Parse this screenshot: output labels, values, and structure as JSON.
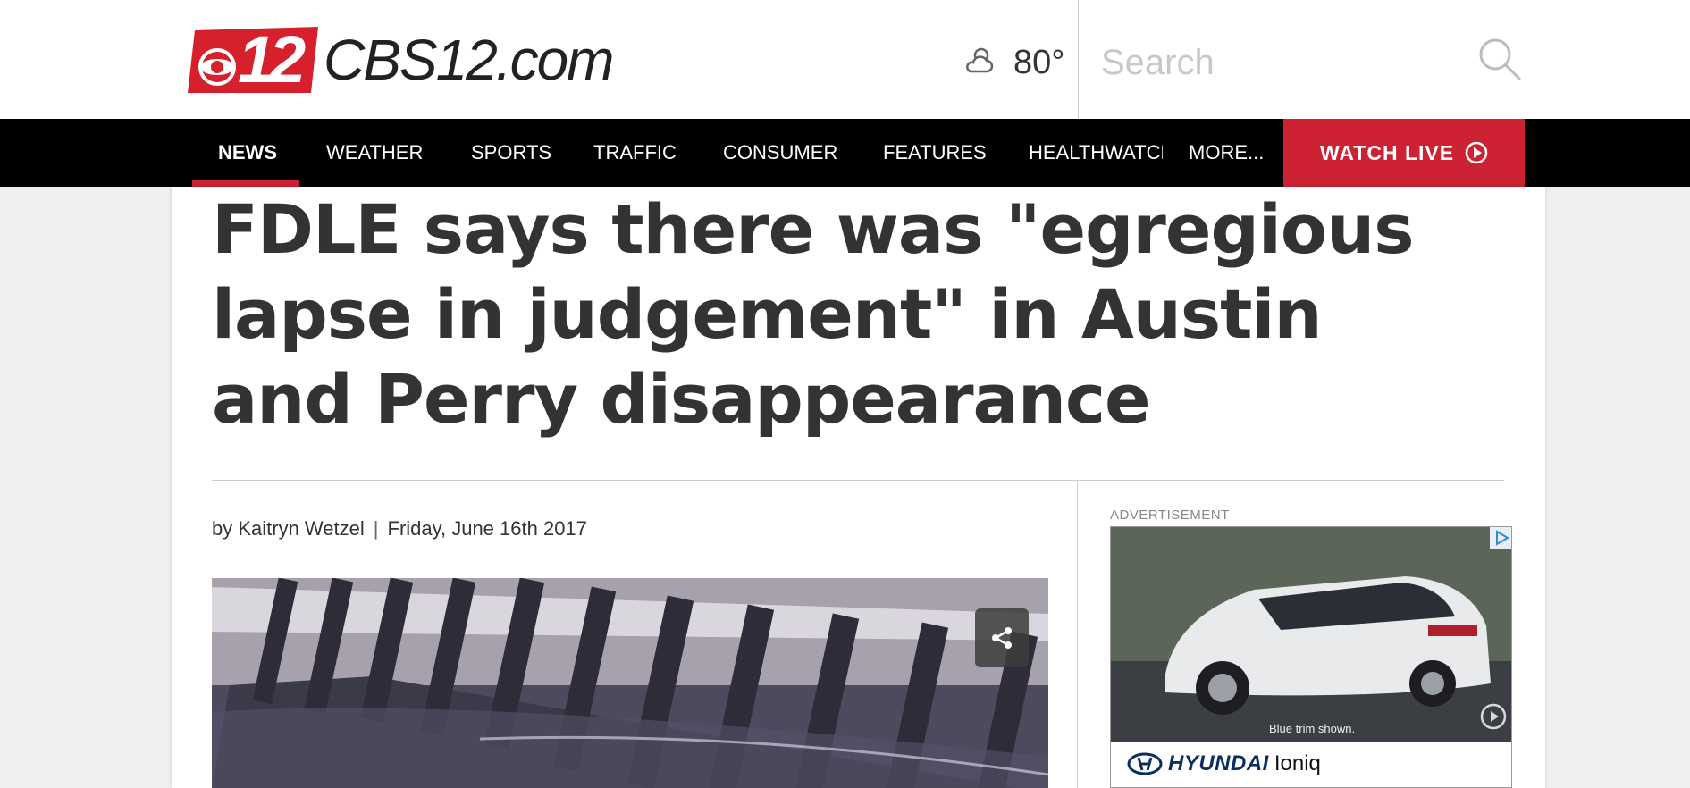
{
  "site": {
    "logo_text": "CBS12.com",
    "logo_badge": "12"
  },
  "weather": {
    "temperature": "80°",
    "icon": "partly-cloudy-icon"
  },
  "search": {
    "placeholder": "Search",
    "icon": "search-icon"
  },
  "nav": {
    "items": [
      {
        "label": "NEWS",
        "active": true
      },
      {
        "label": "WEATHER"
      },
      {
        "label": "SPORTS"
      },
      {
        "label": "TRAFFIC"
      },
      {
        "label": "CONSUMER"
      },
      {
        "label": "FEATURES"
      },
      {
        "label": "HEALTHWATCH"
      },
      {
        "label": "MORE..."
      }
    ],
    "watch_live": "WATCH LIVE",
    "accent_color": "#cc2233"
  },
  "article": {
    "headline": "FDLE says there was \"egregious lapse in judgement\" in Austin and Perry disappearance",
    "author": "by Kaitryn Wetzel",
    "separator": "|",
    "date": "Friday, June 16th 2017",
    "share_icon": "share-icon"
  },
  "ad": {
    "label": "ADVERTISEMENT",
    "caption": "Blue trim shown.",
    "brand": "HYUNDAI",
    "model": "Ioniq",
    "adchoices_icon": "adchoices-icon",
    "replay_icon": "replay-icon"
  }
}
